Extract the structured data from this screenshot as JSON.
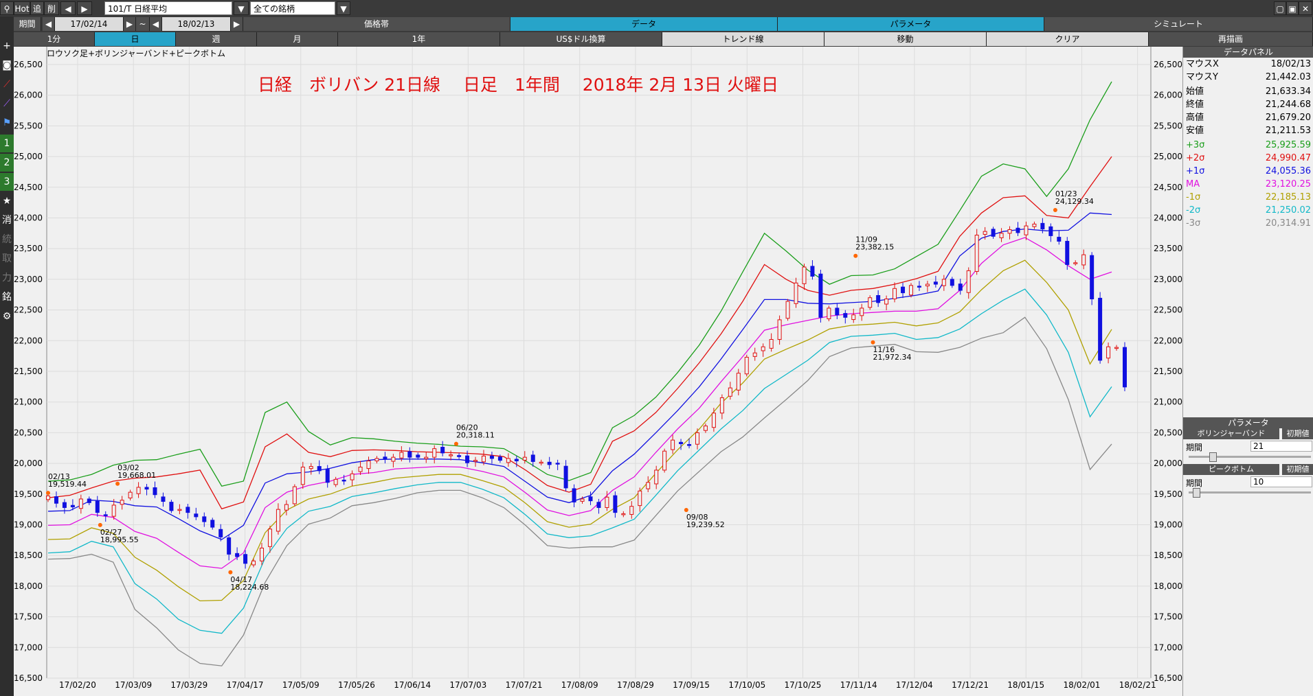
{
  "toolbar": {
    "hot": "Hot",
    "tsui": "追",
    "kezu": "削",
    "symbol": "101/T 日経平均",
    "universe": "全ての銘柄",
    "period_label": "期間",
    "date_from": "17/02/14",
    "tilde": "~",
    "date_to": "18/02/13",
    "tabs": [
      "価格帯",
      "データ",
      "パラメータ",
      "シミュレート"
    ],
    "timeframes": [
      "1分",
      "日",
      "週",
      "月",
      "1年",
      "US$ドル換算",
      "トレンド線",
      "移動",
      "クリア",
      "再描画"
    ]
  },
  "left_tools": [
    "1",
    "2",
    "3",
    "★",
    "消",
    "統",
    "取",
    "力",
    "銘",
    "⚙"
  ],
  "panel": {
    "data_title": "データパネル",
    "rows": [
      {
        "k": "マウスX",
        "v": "18/02/13",
        "c": "#000000"
      },
      {
        "k": "マウスY",
        "v": "21,442.03",
        "c": "#000000"
      },
      {
        "k": "始値",
        "v": "21,633.34",
        "c": "#000000"
      },
      {
        "k": "終値",
        "v": "21,244.68",
        "c": "#000000"
      },
      {
        "k": "高値",
        "v": "21,679.20",
        "c": "#000000"
      },
      {
        "k": "安値",
        "v": "21,211.53",
        "c": "#000000"
      },
      {
        "k": "+3σ",
        "v": "25,925.59",
        "c": "#1a9e1a"
      },
      {
        "k": "+2σ",
        "v": "24,990.47",
        "c": "#e01010"
      },
      {
        "k": "+1σ",
        "v": "24,055.36",
        "c": "#1010e0"
      },
      {
        "k": "MA",
        "v": "23,120.25",
        "c": "#e010e0"
      },
      {
        "k": "-1σ",
        "v": "22,185.13",
        "c": "#b0a000"
      },
      {
        "k": "-2σ",
        "v": "21,250.02",
        "c": "#10b8c8"
      },
      {
        "k": "-3σ",
        "v": "20,314.91",
        "c": "#888888"
      }
    ],
    "param_title": "パラメータ",
    "boll_label": "ボリンジャーバンド",
    "init_label": "初期値",
    "period_label": "期間",
    "boll_period": "21",
    "peak_label": "ピークボトム",
    "peak_period": "10"
  },
  "chart_data": {
    "type": "candlestick",
    "title": "日経　ボリバン 21日線　 日足　1年間　 2018年 2月 13日 火曜日",
    "subtitle": "ロウソク足+ボリンジャーバンド+ピークボトム",
    "y_ticks": [
      16500,
      17000,
      17500,
      18000,
      18500,
      19000,
      19500,
      20000,
      20500,
      21000,
      21500,
      22000,
      22500,
      23000,
      23500,
      24000,
      24500,
      25000,
      25500,
      26000,
      26500
    ],
    "ylim": [
      16500,
      26700
    ],
    "x_ticks": [
      "17/02/20",
      "17/03/09",
      "17/03/29",
      "17/04/17",
      "17/05/09",
      "17/05/26",
      "17/06/14",
      "17/07/03",
      "17/07/21",
      "17/08/09",
      "17/08/29",
      "17/09/15",
      "17/10/05",
      "17/10/25",
      "17/11/14",
      "17/12/04",
      "17/12/21",
      "18/01/15",
      "18/02/01",
      "18/02/21"
    ],
    "bands": {
      "x": [
        0,
        5,
        10,
        15,
        20,
        25,
        30,
        35,
        40,
        45,
        50,
        55,
        60,
        65,
        70,
        75,
        80,
        85,
        90,
        95,
        100,
        105,
        110,
        115,
        120,
        125,
        130,
        135,
        140,
        145,
        150,
        155,
        160,
        165,
        170,
        175,
        180,
        185,
        190,
        195,
        200,
        205,
        210,
        215,
        220,
        225,
        230,
        235,
        240,
        245
      ],
      "plus3": [
        19710,
        19730,
        19820,
        19970,
        20050,
        20060,
        20150,
        20230,
        19630,
        19710,
        20830,
        21000,
        20520,
        20300,
        20420,
        20400,
        20360,
        20330,
        20310,
        20280,
        20270,
        20240,
        20040,
        19820,
        19720,
        19850,
        20580,
        20780,
        21080,
        21480,
        21930,
        22480,
        23120,
        23750,
        23460,
        23150,
        22920,
        23060,
        23070,
        23170,
        23370,
        23570,
        24120,
        24680,
        24880,
        24800,
        24350,
        24800,
        25600,
        26220
      ],
      "plus2": [
        19440,
        19480,
        19600,
        19710,
        19760,
        19780,
        19830,
        19890,
        19260,
        19370,
        20270,
        20480,
        20180,
        20110,
        20210,
        20220,
        20210,
        20190,
        20180,
        20170,
        20150,
        20110,
        19890,
        19640,
        19530,
        19660,
        20360,
        20530,
        20830,
        21220,
        21640,
        22110,
        22640,
        23240,
        23000,
        22820,
        22740,
        22820,
        22850,
        22920,
        23010,
        23130,
        23700,
        24080,
        24330,
        24360,
        24040,
        24000,
        24510,
        25000
      ],
      "plus1": [
        19220,
        19230,
        19400,
        19380,
        19310,
        19290,
        19100,
        18900,
        18760,
        18990,
        19680,
        19830,
        19860,
        19920,
        20010,
        20060,
        20070,
        20070,
        20070,
        20060,
        20010,
        19950,
        19700,
        19450,
        19360,
        19480,
        19880,
        20150,
        20500,
        20860,
        21250,
        21700,
        22180,
        22670,
        22670,
        22610,
        22600,
        22620,
        22640,
        22690,
        22740,
        22810,
        23380,
        23670,
        23780,
        23820,
        23790,
        23800,
        24080,
        24056
      ],
      "ma": [
        18990,
        19000,
        19170,
        19120,
        18890,
        18780,
        18550,
        18330,
        18290,
        18540,
        19280,
        19530,
        19640,
        19710,
        19820,
        19850,
        19910,
        19930,
        19950,
        19940,
        19870,
        19780,
        19520,
        19240,
        19150,
        19230,
        19560,
        19780,
        20180,
        20560,
        20900,
        21330,
        21740,
        22170,
        22260,
        22330,
        22400,
        22440,
        22460,
        22480,
        22480,
        22520,
        22820,
        23260,
        23560,
        23680,
        23480,
        23220,
        23000,
        23120
      ],
      "minus1": [
        18760,
        18770,
        18950,
        18860,
        18470,
        18260,
        17990,
        17760,
        17770,
        18090,
        18870,
        19240,
        19420,
        19500,
        19630,
        19690,
        19760,
        19790,
        19820,
        19820,
        19720,
        19610,
        19350,
        19050,
        18960,
        19010,
        19250,
        19440,
        19840,
        20220,
        20560,
        20980,
        21310,
        21700,
        21860,
        22010,
        22190,
        22250,
        22270,
        22300,
        22240,
        22290,
        22470,
        22830,
        23140,
        23310,
        22950,
        22500,
        21620,
        22185
      ],
      "minus2": [
        18540,
        18560,
        18730,
        18640,
        18040,
        17790,
        17460,
        17280,
        17230,
        17640,
        18460,
        18940,
        19220,
        19300,
        19460,
        19520,
        19590,
        19650,
        19690,
        19690,
        19580,
        19440,
        19160,
        18850,
        18790,
        18820,
        18950,
        19090,
        19480,
        19880,
        20220,
        20560,
        20860,
        21220,
        21450,
        21680,
        21970,
        22070,
        22090,
        22120,
        22020,
        22050,
        22190,
        22440,
        22660,
        22840,
        22420,
        21810,
        20760,
        21250
      ],
      "minus3": [
        18440,
        18450,
        18520,
        18390,
        17620,
        17320,
        16960,
        16740,
        16700,
        17200,
        18060,
        18660,
        19010,
        19110,
        19310,
        19360,
        19430,
        19520,
        19560,
        19560,
        19440,
        19280,
        18990,
        18660,
        18620,
        18640,
        18640,
        18750,
        19150,
        19550,
        19870,
        20190,
        20430,
        20740,
        21040,
        21350,
        21740,
        21880,
        21910,
        21940,
        21820,
        21810,
        21890,
        22040,
        22130,
        22380,
        21870,
        21040,
        19900,
        20315
      ]
    },
    "candles_close": [
      19470,
      19350,
      19280,
      19290,
      19420,
      19360,
      19200,
      19150,
      19320,
      19400,
      19530,
      19610,
      19580,
      19490,
      19380,
      19230,
      19250,
      19200,
      19130,
      19050,
      18960,
      18800,
      18520,
      18480,
      18370,
      18410,
      18620,
      18930,
      19250,
      19330,
      19620,
      19940,
      19950,
      19880,
      19690,
      19740,
      19720,
      19830,
      19940,
      20040,
      20080,
      20070,
      20100,
      20180,
      20100,
      20100,
      20100,
      20240,
      20170,
      20140,
      20110,
      20010,
      20050,
      20120,
      20080,
      20050,
      20080,
      20040,
      20100,
      20030,
      20020,
      19980,
      19990,
      19600,
      19370,
      19420,
      19390,
      19280,
      19450,
      19200,
      19180,
      19300,
      19550,
      19690,
      19890,
      20200,
      20380,
      20320,
      20300,
      20500,
      20610,
      20820,
      21070,
      21230,
      21470,
      21730,
      21800,
      21900,
      22020,
      22340,
      22640,
      22940,
      23200,
      23050,
      22380,
      22530,
      22420,
      22380,
      22420,
      22530,
      22700,
      22620,
      22680,
      22850,
      22780,
      22900,
      22880,
      22920,
      22920,
      23000,
      22900,
      22820,
      23140,
      23720,
      23780,
      23700,
      23750,
      23810,
      23760,
      23870,
      23900,
      23820,
      23710,
      23620,
      23240,
      23270,
      23400,
      22680,
      21680,
      21900,
      21890,
      21245
    ],
    "peaks": [
      {
        "label": "02/13",
        "value": "19,519.44"
      },
      {
        "label": "03/02",
        "value": "19,668.01"
      },
      {
        "label": "02/27",
        "value": "18,995.55"
      },
      {
        "label": "04/17",
        "value": "18,224.68"
      },
      {
        "label": "06/20",
        "value": "20,318.11"
      },
      {
        "label": "09/08",
        "value": "19,239.52"
      },
      {
        "label": "11/09",
        "value": "23,382.15"
      },
      {
        "label": "11/16",
        "value": "21,972.34"
      },
      {
        "label": "01/23",
        "value": "24,129.34"
      }
    ],
    "colors": {
      "plus3": "#1a9e1a",
      "plus2": "#e01010",
      "plus1": "#1010e0",
      "ma": "#e010e0",
      "minus1": "#b0a000",
      "minus2": "#10b8c8",
      "minus3": "#888888",
      "up": "#e01010",
      "down": "#1010e0",
      "title": "#e01010"
    },
    "grid": true
  }
}
